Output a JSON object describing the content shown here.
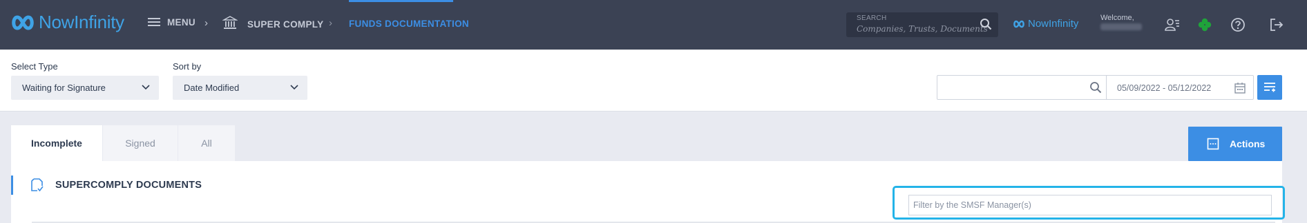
{
  "topbar": {
    "brand": "NowInfinity",
    "menu_label": "MENU",
    "breadcrumb_separator": "›",
    "crumb_super_comply": "SUPER COMPLY",
    "crumb_funds": "FUNDS DOCUMENTATION",
    "search_label": "SEARCH",
    "search_placeholder": "Companies,  Trusts,  Documents",
    "brand_small": "NowInfinity",
    "welcome": "Welcome,",
    "colors": {
      "bar": "#3b4254",
      "accent": "#3c8ee4",
      "brand": "#3fa3e6"
    }
  },
  "filters": {
    "select_type_label": "Select Type",
    "select_type_value": "Waiting for Signature",
    "sort_by_label": "Sort by",
    "sort_by_value": "Date Modified",
    "date_range": "05/09/2022  -  05/12/2022"
  },
  "tabs": [
    {
      "label": "Incomplete",
      "active": true
    },
    {
      "label": "Signed",
      "active": false
    },
    {
      "label": "All",
      "active": false
    }
  ],
  "actions_label": "Actions",
  "panel": {
    "title": "SUPERCOMPLY DOCUMENTS",
    "filter_placeholder": "Filter by the SMSF Manager(s)"
  },
  "icons": [
    "brand-logo-icon",
    "hamburger-icon",
    "bank-icon",
    "search-icon",
    "user-list-icon",
    "clover-icon",
    "help-icon",
    "logout-icon",
    "chevron-down-icon",
    "calendar-icon",
    "list-settings-icon",
    "actions-icon",
    "document-check-icon"
  ]
}
